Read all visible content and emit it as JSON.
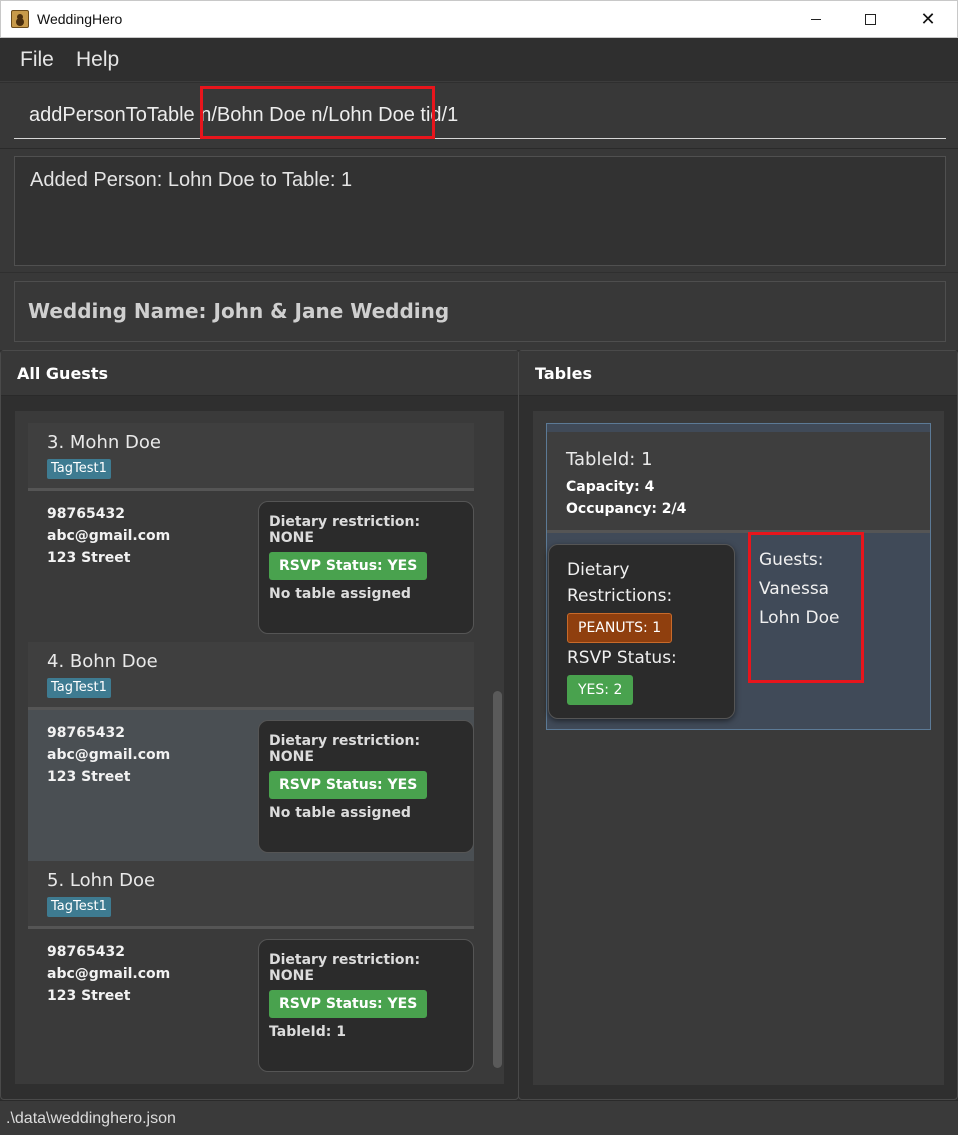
{
  "window": {
    "title": "WeddingHero"
  },
  "menu": {
    "file": "File",
    "help": "Help"
  },
  "command": {
    "value": "addPersonToTable n/Bohn Doe n/Lohn Doe tid/1"
  },
  "result": {
    "text": "Added Person: Lohn Doe to Table: 1"
  },
  "wedding": {
    "name": "Wedding Name: John & Jane Wedding"
  },
  "guests_panel": {
    "title": "All Guests",
    "guests": [
      {
        "name": "3. Mohn Doe",
        "tag": "TagTest1",
        "phone": "98765432",
        "email": "abc@gmail.com",
        "address": "123 Street",
        "dietary": "Dietary restriction: NONE",
        "rsvp": "RSVP Status: YES",
        "table": "No table assigned"
      },
      {
        "name": "4. Bohn Doe",
        "tag": "TagTest1",
        "phone": "98765432",
        "email": "abc@gmail.com",
        "address": "123 Street",
        "dietary": "Dietary restriction: NONE",
        "rsvp": "RSVP Status: YES",
        "table": "No table assigned"
      },
      {
        "name": "5. Lohn Doe",
        "tag": "TagTest1",
        "phone": "98765432",
        "email": "abc@gmail.com",
        "address": "123 Street",
        "dietary": "Dietary restriction: NONE",
        "rsvp": "RSVP Status: YES",
        "table": "TableId: 1"
      }
    ]
  },
  "tables_panel": {
    "title": "Tables",
    "tables": [
      {
        "id": "TableId: 1",
        "capacity": "Capacity: 4",
        "occupancy": "Occupancy: 2/4",
        "dietary_label_1": "Dietary",
        "dietary_label_2": "Restrictions:",
        "dietary_badge": "PEANUTS: 1",
        "rsvp_label": "RSVP Status:",
        "rsvp_badge": "YES: 2",
        "guests_label": "Guests:",
        "guests": [
          "Vanessa",
          "Lohn Doe"
        ]
      }
    ]
  },
  "status": {
    "path": ".\\data\\weddinghero.json"
  },
  "colors": {
    "background": "#2f2f2f",
    "rsvp_green": "#49a24e",
    "tag_blue": "#3e7b91",
    "peanut_orange": "#8f3f0e",
    "highlight_red": "#e8151c",
    "table_card": "#404a58"
  },
  "icons": {
    "app": "wedding-hero-app-icon",
    "minimize": "minimize-icon",
    "maximize": "maximize-icon",
    "close": "close-icon"
  }
}
